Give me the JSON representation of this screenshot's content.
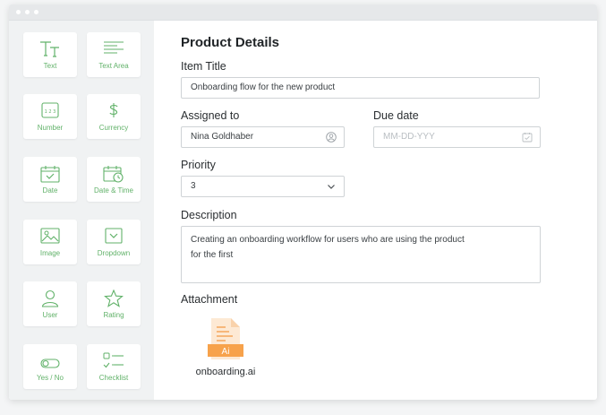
{
  "palette": {
    "items": [
      {
        "label": "Text",
        "icon": "text-icon"
      },
      {
        "label": "Text Area",
        "icon": "text-area-icon"
      },
      {
        "label": "Number",
        "icon": "number-icon"
      },
      {
        "label": "Currency",
        "icon": "dollar-icon"
      },
      {
        "label": "Date",
        "icon": "calendar-icon"
      },
      {
        "label": "Date & Time",
        "icon": "calendar-clock-icon"
      },
      {
        "label": "Image",
        "icon": "image-icon"
      },
      {
        "label": "Dropdown",
        "icon": "dropdown-icon"
      },
      {
        "label": "User",
        "icon": "user-icon"
      },
      {
        "label": "Rating",
        "icon": "star-icon"
      },
      {
        "label": "Yes / No",
        "icon": "toggle-icon"
      },
      {
        "label": "Checklist",
        "icon": "checklist-icon"
      }
    ],
    "number_glyph": "1 2 3"
  },
  "form": {
    "title": "Product Details",
    "item_title": {
      "label": "Item Title",
      "value": "Onboarding flow for the new product"
    },
    "assigned_to": {
      "label": "Assigned to",
      "value": "Nina Goldhaber"
    },
    "due_date": {
      "label": "Due date",
      "placeholder": "MM-DD-YYY"
    },
    "priority": {
      "label": "Priority",
      "value": "3"
    },
    "description": {
      "label": "Description",
      "value": "Creating an onboarding workflow for users who are using the product for the first"
    },
    "attachment": {
      "label": "Attachment",
      "file_name": "onboarding.ai",
      "file_badge": "Ai"
    }
  },
  "colors": {
    "accent_green": "#62b26a",
    "ai_orange": "#f7a24b",
    "ai_light": "#fde9d4"
  }
}
